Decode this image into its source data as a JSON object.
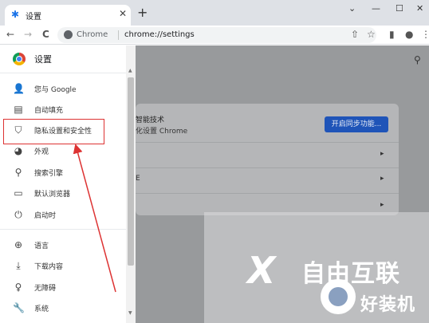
{
  "tab": {
    "title": "设置",
    "close": "✕",
    "new_tab": "+"
  },
  "window": {
    "minimize": "—",
    "maximize": "☐",
    "close": "✕",
    "expand": "⌄"
  },
  "toolbar": {
    "back": "←",
    "forward": "→",
    "reload": "C",
    "site_name": "Chrome",
    "url": "chrome://settings"
  },
  "drawer": {
    "title": "设置",
    "items": [
      {
        "label": "您与 Google",
        "icon": "person-icon"
      },
      {
        "label": "自动填充",
        "icon": "clipboard-icon"
      },
      {
        "label": "隐私设置和安全性",
        "icon": "shield-icon"
      },
      {
        "label": "外观",
        "icon": "palette-icon"
      },
      {
        "label": "搜索引擎",
        "icon": "search-icon"
      },
      {
        "label": "默认浏览器",
        "icon": "browser-icon"
      },
      {
        "label": "启动时",
        "icon": "power-icon"
      },
      {
        "label": "语言",
        "icon": "globe-icon"
      },
      {
        "label": "下载内容",
        "icon": "download-icon"
      },
      {
        "label": "无障碍",
        "icon": "accessibility-icon"
      },
      {
        "label": "系统",
        "icon": "wrench-icon"
      }
    ]
  },
  "main": {
    "card_line1": "智能技术",
    "card_line2": "化设置 Chrome",
    "card_line3": "E",
    "sync_button": "开启同步功能..."
  },
  "watermark": {
    "brand": "自由互联",
    "brand2": "好装机"
  },
  "colors": {
    "accent": "#1a73e8",
    "highlight": "#dd3333",
    "sync_button": "#1f54b8"
  }
}
